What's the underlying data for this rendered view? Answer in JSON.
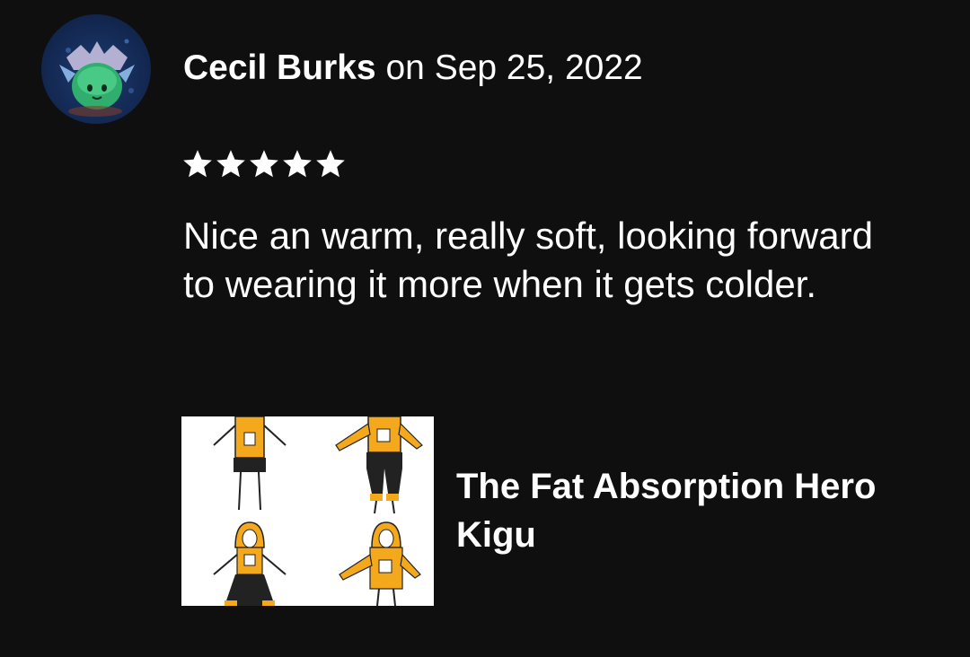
{
  "review": {
    "reviewer_name": "Cecil Burks",
    "date_prefix": "on",
    "date": "Sep 25, 2022",
    "rating": 5,
    "rating_max": 5,
    "text": "Nice an warm, really soft, looking forward to wearing it more when it gets colder."
  },
  "product": {
    "title": "The Fat Absorption Hero Kigu"
  },
  "colors": {
    "background": "#0f0f0f",
    "text": "#ffffff",
    "star": "#ffffff"
  }
}
